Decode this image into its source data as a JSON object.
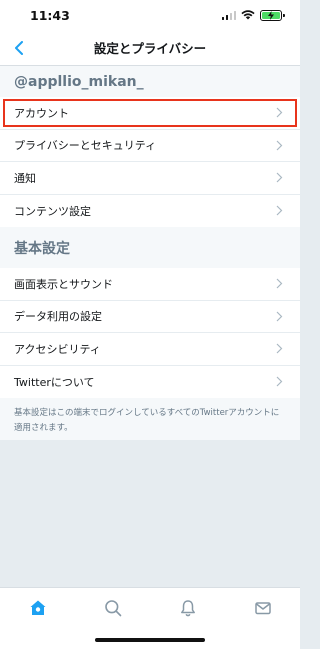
{
  "status_bar": {
    "time": "11:43"
  },
  "nav": {
    "title": "設定とプライバシー"
  },
  "account": {
    "handle": "@appllio_mikan_",
    "items": [
      {
        "label": "アカウント"
      },
      {
        "label": "プライバシーとセキュリティ"
      },
      {
        "label": "通知"
      },
      {
        "label": "コンテンツ設定"
      }
    ]
  },
  "general": {
    "header": "基本設定",
    "items": [
      {
        "label": "画面表示とサウンド"
      },
      {
        "label": "データ利用の設定"
      },
      {
        "label": "アクセシビリティ"
      },
      {
        "label": "Twitterについて"
      }
    ],
    "note": "基本設定はこの端末でログインしているすべてのTwitterアカウントに適用されます。"
  },
  "colors": {
    "accent": "#1da1f2",
    "highlight": "#e8341c",
    "section_text": "#657786"
  },
  "tab_bar": {
    "icons": [
      "home-icon",
      "search-icon",
      "bell-icon",
      "mail-icon"
    ]
  }
}
